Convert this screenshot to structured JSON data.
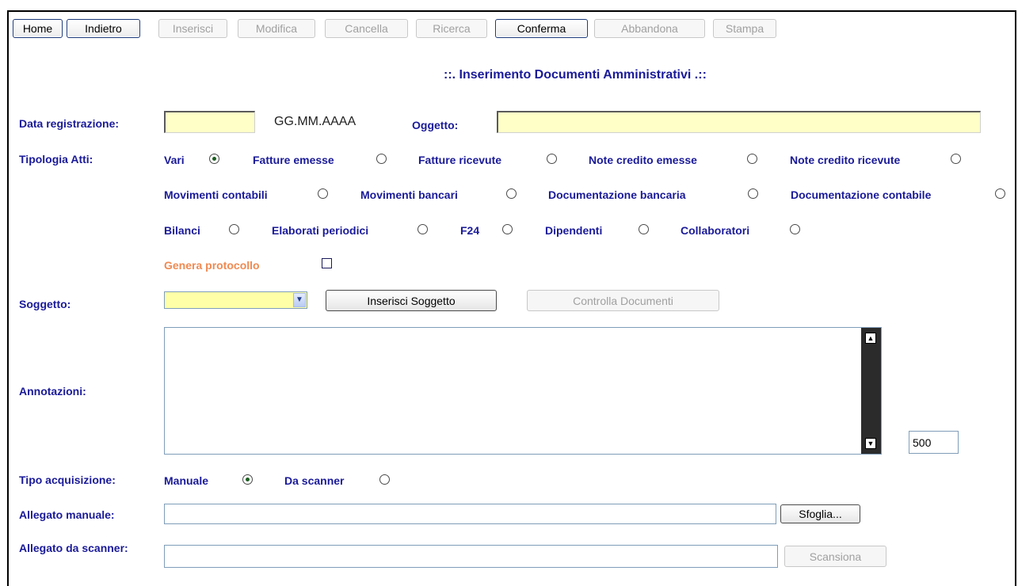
{
  "toolbar": {
    "home": "Home",
    "back": "Indietro",
    "insert": "Inserisci",
    "edit": "Modifica",
    "delete": "Cancella",
    "search": "Ricerca",
    "confirm": "Conferma",
    "abandon": "Abbandona",
    "print": "Stampa"
  },
  "page_title": "::. Inserimento Documenti Amministrativi .::",
  "form": {
    "data_registrazione_label": "Data registrazione:",
    "data_registrazione_value": "",
    "date_format_hint": "GG.MM.AAAA",
    "oggetto_label": "Oggetto:",
    "oggetto_value": "",
    "tipologia_label": "Tipologia Atti:",
    "tipologia_options": [
      "Vari",
      "Fatture emesse",
      "Fatture ricevute",
      "Note credito emesse",
      "Note credito ricevute",
      "Movimenti contabili",
      "Movimenti bancari",
      "Documentazione bancaria",
      "Documentazione contabile",
      "Bilanci",
      "Elaborati periodici",
      "F24",
      "Dipendenti",
      "Collaboratori"
    ],
    "tipologia_selected": "Vari",
    "genera_protocollo_label": "Genera protocollo",
    "genera_protocollo_checked": false,
    "soggetto_label": "Soggetto:",
    "soggetto_value": "",
    "inserisci_soggetto_button": "Inserisci Soggetto",
    "controlla_documenti_button": "Controlla Documenti",
    "annotazioni_label": "Annotazioni:",
    "annotazioni_value": "",
    "char_counter": "500",
    "tipo_acquisizione_label": "Tipo acquisizione:",
    "acquisizione_options": [
      "Manuale",
      "Da scanner"
    ],
    "acquisizione_selected": "Manuale",
    "allegato_manuale_label": "Allegato manuale:",
    "allegato_manuale_value": "",
    "sfoglia_button": "Sfoglia...",
    "allegato_scanner_label": "Allegato da scanner:",
    "allegato_scanner_value": "",
    "scansiona_button": "Scansiona"
  },
  "colors": {
    "label_blue": "#1a1a99",
    "orange": "#f08a52",
    "input_yellow": "#ffffc8"
  }
}
